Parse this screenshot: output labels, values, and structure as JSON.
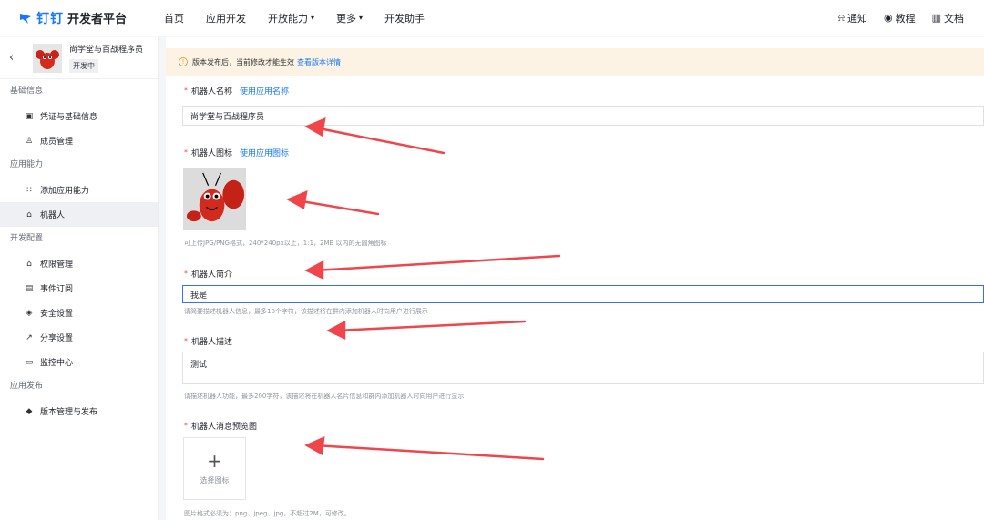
{
  "topbar": {
    "brand_ding": "钉钉",
    "brand_title": "开发者平台",
    "nav": [
      {
        "label": "首页",
        "chevron": false
      },
      {
        "label": "应用开发",
        "chevron": false
      },
      {
        "label": "开放能力",
        "chevron": true
      },
      {
        "label": "更多",
        "chevron": true
      },
      {
        "label": "开发助手",
        "chevron": false
      }
    ],
    "right": [
      {
        "icon": "bell-icon",
        "label": "通知"
      },
      {
        "icon": "location-pin-icon",
        "label": "教程"
      },
      {
        "icon": "book-icon",
        "label": "文档"
      }
    ]
  },
  "sidebar": {
    "app_name": "尚学堂与百战程序员",
    "app_status": "开发中",
    "groups": [
      {
        "title": "基础信息",
        "items": [
          {
            "label": "凭证与基础信息",
            "icon": "credential-icon",
            "active": false
          },
          {
            "label": "成员管理",
            "icon": "user-icon",
            "active": false
          }
        ]
      },
      {
        "title": "应用能力",
        "items": [
          {
            "label": "添加应用能力",
            "icon": "capability-icon",
            "active": false
          },
          {
            "label": "机器人",
            "icon": "robot-icon",
            "active": true
          }
        ]
      },
      {
        "title": "开发配置",
        "items": [
          {
            "label": "权限管理",
            "icon": "lock-icon",
            "active": false
          },
          {
            "label": "事件订阅",
            "icon": "event-icon",
            "active": false
          },
          {
            "label": "安全设置",
            "icon": "shield-icon",
            "active": false
          },
          {
            "label": "分享设置",
            "icon": "share-icon",
            "active": false
          },
          {
            "label": "监控中心",
            "icon": "monitor-icon",
            "active": false
          }
        ]
      },
      {
        "title": "应用发布",
        "items": [
          {
            "label": "版本管理与发布",
            "icon": "version-icon",
            "active": false
          }
        ]
      }
    ]
  },
  "banner": {
    "text": "版本发布后，当前修改才能生效",
    "link": "查看版本详情"
  },
  "form": {
    "name_label": "机器人名称",
    "name_link": "使用应用名称",
    "name_value": "尚学堂与百战程序员",
    "icon_label": "机器人图标",
    "icon_link": "使用应用图标",
    "icon_hint": "可上传JPG/PNG格式，240*240px以上，1:1，2MB 以内的无圆角图标",
    "intro_label": "机器人简介",
    "intro_value": "我是",
    "intro_hint": "请简要描述机器人信息，最多10个字符，该描述将在群内添加机器人时向用户进行展示",
    "desc_label": "机器人描述",
    "desc_value": "测试",
    "desc_hint": "请描述机器人功能，最多200字符，该描述将在机器人名片信息和群内添加机器人时向用户进行显示",
    "preview_label": "机器人消息预览图",
    "upload_text": "选择图标",
    "preview_hint": "图片格式必须为：png、jpeg、jpg，不超过2M，可修改。"
  },
  "colors": {
    "accent": "#1677ff",
    "required": "#f54a45",
    "annotation_arrow": "#f0454a"
  }
}
